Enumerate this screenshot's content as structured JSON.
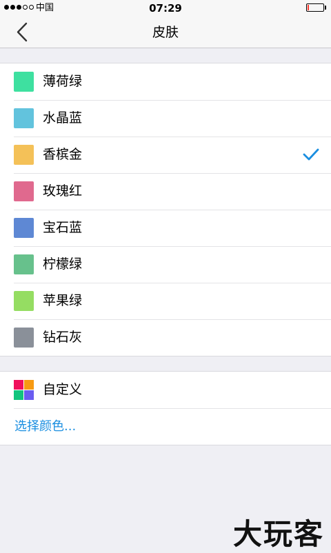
{
  "status_bar": {
    "carrier": "中国",
    "time": "07:29",
    "signal_dots": [
      true,
      true,
      true,
      false,
      false
    ],
    "battery_level": 0.1,
    "battery_color": "#ff3b30"
  },
  "nav": {
    "title": "皮肤",
    "back_icon": "chevron-left-icon"
  },
  "skins": [
    {
      "label": "薄荷绿",
      "color": "#3ee0a0",
      "selected": false
    },
    {
      "label": "水晶蓝",
      "color": "#62c3dd",
      "selected": false
    },
    {
      "label": "香槟金",
      "color": "#f4c158",
      "selected": true
    },
    {
      "label": "玫瑰红",
      "color": "#e0698e",
      "selected": false
    },
    {
      "label": "宝石蓝",
      "color": "#5e88d4",
      "selected": false
    },
    {
      "label": "柠檬绿",
      "color": "#67c18c",
      "selected": false
    },
    {
      "label": "苹果绿",
      "color": "#95dd62",
      "selected": false
    },
    {
      "label": "钻石灰",
      "color": "#8a9099",
      "selected": false
    }
  ],
  "custom": {
    "label": "自定义",
    "swatch_colors": [
      "#f0105c",
      "#f79a12",
      "#12c47d",
      "#6a5cf0"
    ],
    "choose_color_label": "选择颜色..."
  },
  "accent_color": "#1a8ee0",
  "watermark": "大玩客"
}
